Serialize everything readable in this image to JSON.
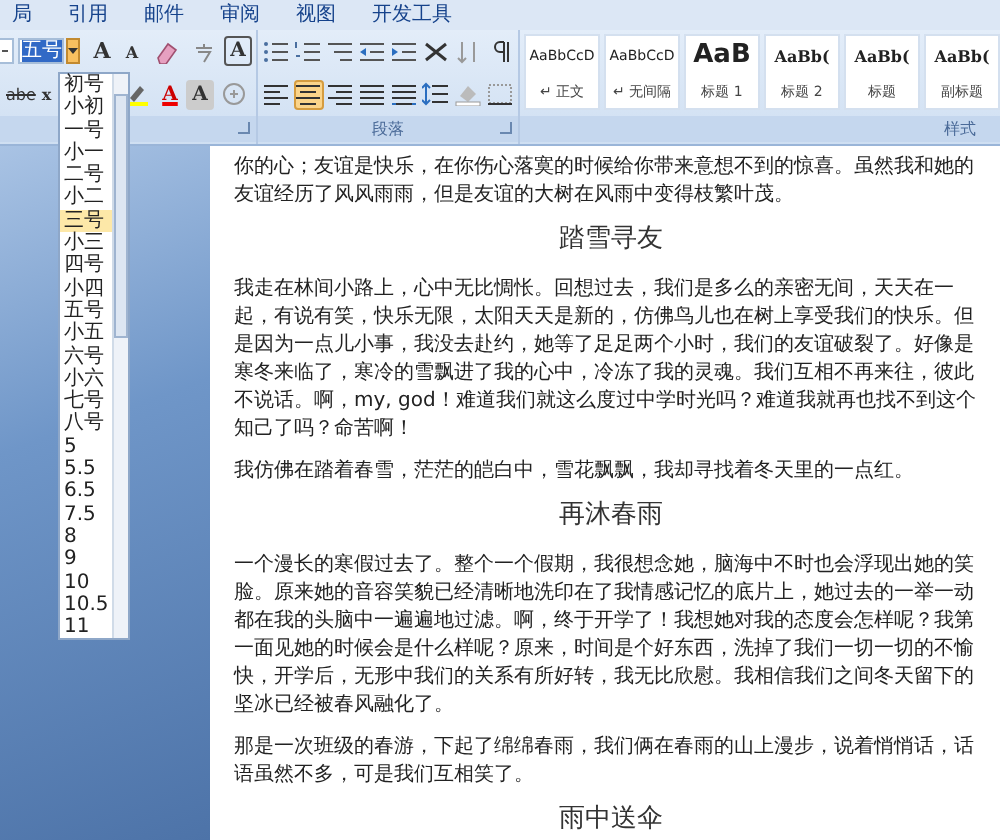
{
  "ribbon_tabs": [
    {
      "label": "局",
      "selected": false
    },
    {
      "label": "引用",
      "selected": false
    },
    {
      "label": "邮件",
      "selected": false
    },
    {
      "label": "审阅",
      "selected": false
    },
    {
      "label": "视图",
      "selected": false
    },
    {
      "label": "开发工具",
      "selected": false
    }
  ],
  "font_group": {
    "font_size": "五号",
    "size_list": {
      "open": true,
      "items": [
        {
          "label": "初号",
          "selected": false
        },
        {
          "label": "小初",
          "selected": false
        },
        {
          "label": "一号",
          "selected": false
        },
        {
          "label": "小一",
          "selected": false
        },
        {
          "label": "二号",
          "selected": false
        },
        {
          "label": "小二",
          "selected": false
        },
        {
          "label": "三号",
          "selected": true
        },
        {
          "label": "小三",
          "selected": false
        },
        {
          "label": "四号",
          "selected": false
        },
        {
          "label": "小四",
          "selected": false
        },
        {
          "label": "五号",
          "selected": false
        },
        {
          "label": "小五",
          "selected": false
        },
        {
          "label": "六号",
          "selected": false
        },
        {
          "label": "小六",
          "selected": false
        },
        {
          "label": "七号",
          "selected": false
        },
        {
          "label": "八号",
          "selected": false
        },
        {
          "label": "5",
          "selected": false
        },
        {
          "label": "5.5",
          "selected": false
        },
        {
          "label": "6.5",
          "selected": false
        },
        {
          "label": "7.5",
          "selected": false
        },
        {
          "label": "8",
          "selected": false
        },
        {
          "label": "9",
          "selected": false
        },
        {
          "label": "10",
          "selected": false
        },
        {
          "label": "10.5",
          "selected": false
        },
        {
          "label": "11",
          "selected": false
        }
      ]
    },
    "row1": [
      {
        "kind": "grow",
        "label": "A"
      },
      {
        "kind": "shrink",
        "label": "A"
      },
      {
        "kind": "clear"
      },
      {
        "kind": "phonetic"
      },
      {
        "kind": "border",
        "label": "A"
      }
    ],
    "row2_left": [
      {
        "kind": "strike",
        "label": "abe"
      },
      {
        "kind": "sub",
        "label": "x"
      }
    ],
    "row2": [
      {
        "kind": "highlight"
      },
      {
        "kind": "color",
        "label": "A"
      },
      {
        "kind": "shade",
        "label": "A"
      },
      {
        "kind": "enclose"
      }
    ]
  },
  "paragraph_group": {
    "label": "段落",
    "row1": [
      {
        "kind": "bullets",
        "selected": false
      },
      {
        "kind": "numbering",
        "selected": false
      },
      {
        "kind": "multilevel",
        "selected": false
      },
      {
        "kind": "outdent",
        "selected": false
      },
      {
        "kind": "indent",
        "selected": false
      },
      {
        "kind": "asian",
        "selected": false
      },
      {
        "kind": "sort",
        "selected": false
      },
      {
        "kind": "marks",
        "selected": false
      }
    ],
    "row2": [
      {
        "kind": "left",
        "selected": false
      },
      {
        "kind": "center",
        "selected": true
      },
      {
        "kind": "right",
        "selected": false
      },
      {
        "kind": "justify",
        "selected": false
      },
      {
        "kind": "distribute",
        "selected": false
      },
      {
        "kind": "spacing",
        "selected": false
      },
      {
        "kind": "shading",
        "selected": false
      },
      {
        "kind": "borders",
        "selected": false
      }
    ]
  },
  "styles_group": {
    "label": "样式",
    "styles": [
      {
        "kind": "plain",
        "sample": "AaBbCcD",
        "name": "↵ 正文"
      },
      {
        "kind": "plain",
        "sample": "AaBbCcD",
        "name": "↵ 无间隔"
      },
      {
        "kind": "big",
        "sample": "AaB",
        "name": "标题 1"
      },
      {
        "kind": "serif",
        "sample": "AaBb(",
        "name": "标题 2"
      },
      {
        "kind": "serif",
        "sample": "AaBb(",
        "name": "标题"
      },
      {
        "kind": "serif",
        "sample": "AaBb(",
        "name": "副标题"
      }
    ]
  },
  "document": {
    "blocks": [
      {
        "kind": "paragraph",
        "text": "你的心；友谊是快乐，在你伤心落寞的时候给你带来意想不到的惊喜。虽然我和她的友谊经历了风风雨雨，但是友谊的大树在风雨中变得枝繁叶茂。"
      },
      {
        "kind": "heading",
        "text": "踏雪寻友"
      },
      {
        "kind": "paragraph",
        "text": "我走在林间小路上，心中无比惆怅。回想过去，我们是多么的亲密无间，天天在一起，有说有笑，快乐无限，太阳天天是新的，仿佛鸟儿也在树上享受我们的快乐。但是因为一点儿小事，我没去赴约，她等了足足两个小时，我们的友谊破裂了。好像是寒冬来临了，寒冷的雪飘进了我的心中，冷冻了我的灵魂。我们互相不再来往，彼此不说话。啊，my, god！难道我们就这么度过中学时光吗？难道我就再也找不到这个知己了吗？命苦啊！"
      },
      {
        "kind": "paragraph",
        "text": "我仿佛在踏着春雪，茫茫的皑白中，雪花飘飘，我却寻找着冬天里的一点红。"
      },
      {
        "kind": "heading",
        "text": "再沐春雨"
      },
      {
        "kind": "paragraph",
        "text": "一个漫长的寒假过去了。整个一个假期，我很想念她，脑海中不时也会浮现出她的笑脸。原来她的音容笑貌已经清晰地洗印在了我情感记忆的底片上，她过去的一举一动都在我的头脑中一遍遍地过滤。啊，终于开学了！我想她对我的态度会怎样呢？我第一面见她的时候会是什么样呢？原来，时间是个好东西，洗掉了我们一切一切的不愉快，开学后，无形中我们的关系有所好转，我无比欣慰。我相信我们之间冬天留下的坚冰已经被春风融化了。"
      },
      {
        "kind": "paragraph",
        "text": "那是一次班级的春游，下起了绵绵春雨，我们俩在春雨的山上漫步，说着悄悄话，话语虽然不多，可是我们互相笑了。"
      },
      {
        "kind": "heading",
        "text": "雨中送伞"
      }
    ]
  }
}
